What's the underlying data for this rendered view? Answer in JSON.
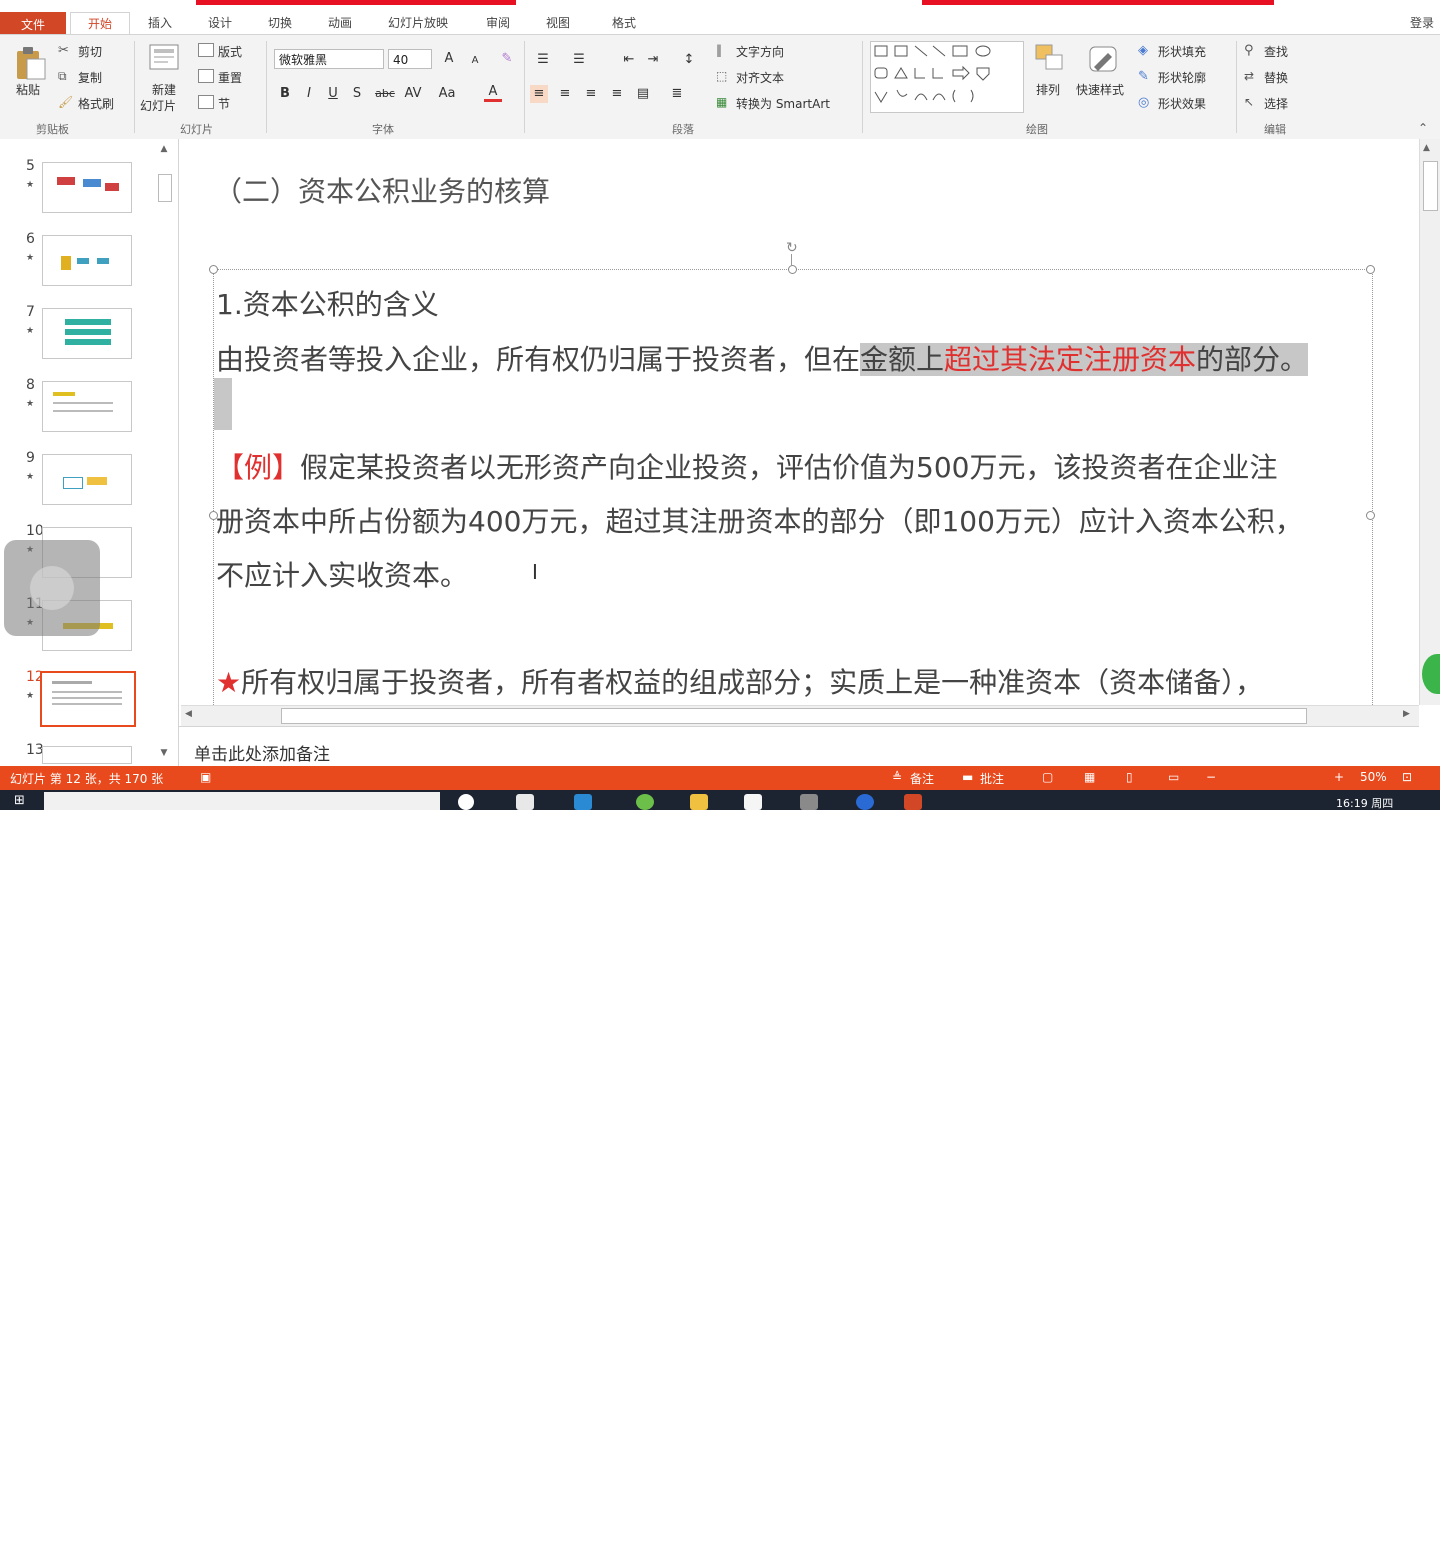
{
  "ribbon_tabs": [
    "文件",
    "开始",
    "插入",
    "设计",
    "切换",
    "动画",
    "幻灯片放映",
    "审阅",
    "视图",
    "格式"
  ],
  "login": "登录",
  "clipboard": {
    "paste": "粘贴",
    "cut": "剪切",
    "copy": "复制",
    "format_painter": "格式刷",
    "group": "剪贴板"
  },
  "slides_group": {
    "new_slide": "新建",
    "new_slide2": "幻灯片",
    "layout": "版式",
    "reset": "重置",
    "section": "节",
    "group": "幻灯片"
  },
  "font": {
    "name": "微软雅黑",
    "size": "40",
    "bold": "B",
    "italic": "I",
    "underline": "U",
    "shadow": "S",
    "strike": "abc",
    "spacing": "AV",
    "case": "Aa",
    "color_a": "A",
    "grow": "A",
    "shrink": "A",
    "group": "字体"
  },
  "paragraph": {
    "text_direction": "文字方向",
    "align_text": "对齐文本",
    "smartart": "转换为 SmartArt",
    "group": "段落"
  },
  "drawing": {
    "arrange": "排列",
    "quick_styles": "快速样式",
    "fill": "形状填充",
    "outline": "形状轮廓",
    "effects": "形状效果",
    "group": "绘图"
  },
  "editing": {
    "find": "查找",
    "replace": "替换",
    "select": "选择",
    "group": "编辑"
  },
  "thumbnails": [
    {
      "num": "5",
      "star": "★"
    },
    {
      "num": "6",
      "star": "★"
    },
    {
      "num": "7",
      "star": "★"
    },
    {
      "num": "8",
      "star": "★"
    },
    {
      "num": "9",
      "star": "★"
    },
    {
      "num": "10",
      "star": "★"
    },
    {
      "num": "11",
      "star": "★"
    },
    {
      "num": "12",
      "star": "★"
    },
    {
      "num": "13",
      "star": ""
    }
  ],
  "slide": {
    "title": "（二）资本公积业务的核算",
    "heading": "1.资本公积的含义",
    "def_part1": "由投资者等投入企业，所有权仍归属于投资者，但在",
    "def_hl1": "金额上",
    "def_red": "超过其法定注册资本",
    "def_hl2": "的部分。",
    "ex_tag": "【例】",
    "ex_line1": "假定某投资者以无形资产向企业投资，评估价值为500万元，该投资者在企业注",
    "ex_line2": "册资本中所占份额为400万元，超过其注册资本的部分（即100万元）应计入资本公积，",
    "ex_line3": "不应计入实收资本。",
    "star_mark": "★",
    "star_line": "所有权归属于投资者，所有者权益的组成部分；实质上是一种准资本（资本储备），"
  },
  "notes_placeholder": "单击此处添加备注",
  "status": {
    "slide_info": "幻灯片 第 12 张，共 170 张",
    "notes": "备注",
    "comments": "批注",
    "zoom": "50%"
  },
  "taskbar": {
    "time": "16:19 周四"
  },
  "colors": {
    "accent": "#d24726",
    "status_bar": "#e8491d",
    "red_text": "#e0302f"
  }
}
